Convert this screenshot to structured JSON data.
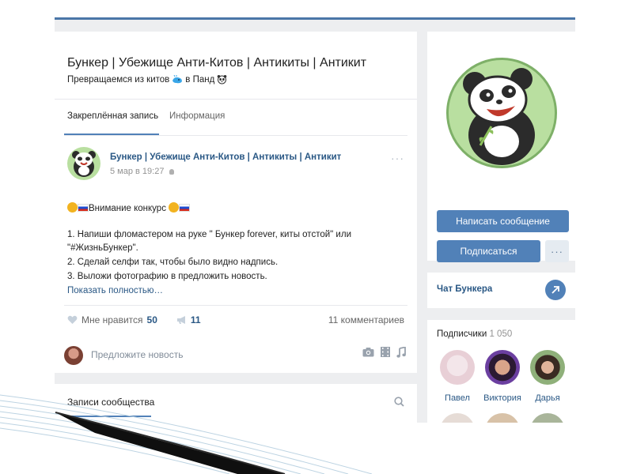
{
  "group": {
    "title": "Бункер | Убежище Анти-Китов | Антикиты | Антикит",
    "status_before": "Превращаемся из китов",
    "status_mid": "в Панд"
  },
  "tabs": [
    {
      "label": "Закреплённая запись",
      "active": true
    },
    {
      "label": "Информация",
      "active": false
    }
  ],
  "post": {
    "author": "Бункер | Убежище Анти-Китов | Антикиты | Антикит",
    "date": "5 мар в 19:27",
    "more": "···",
    "contest": "Внимание конкурс",
    "lines": [
      "1. Напиши фломастером на руке \" Бункер forever, киты отстой\" или",
      "\"#ЖизньБункер\".",
      "2. Сделай селфи так, чтобы было видно надпись.",
      "3. Выложи фотографию в предложить новость."
    ],
    "show_more": "Показать полностью…",
    "likes_label": "Мне нравится",
    "likes_count": "50",
    "reposts_count": "11",
    "comments": "11 комментариев"
  },
  "suggest": {
    "placeholder": "Предложите новость"
  },
  "community_posts": {
    "title": "Записи сообщества"
  },
  "sidebar": {
    "write_button": "Написать сообщение",
    "subscribe_button": "Подписаться",
    "more_button": "···",
    "chat_label": "Чат Бункера",
    "subscribers_title": "Подписчики",
    "subscribers_count": "1 050",
    "subscribers": [
      "Павел",
      "Виктория",
      "Дарья"
    ]
  },
  "colors": {
    "accent": "#5181b8",
    "link": "#2a5885",
    "background": "#edeef0",
    "avatar_bg": "#b9dfa0"
  }
}
